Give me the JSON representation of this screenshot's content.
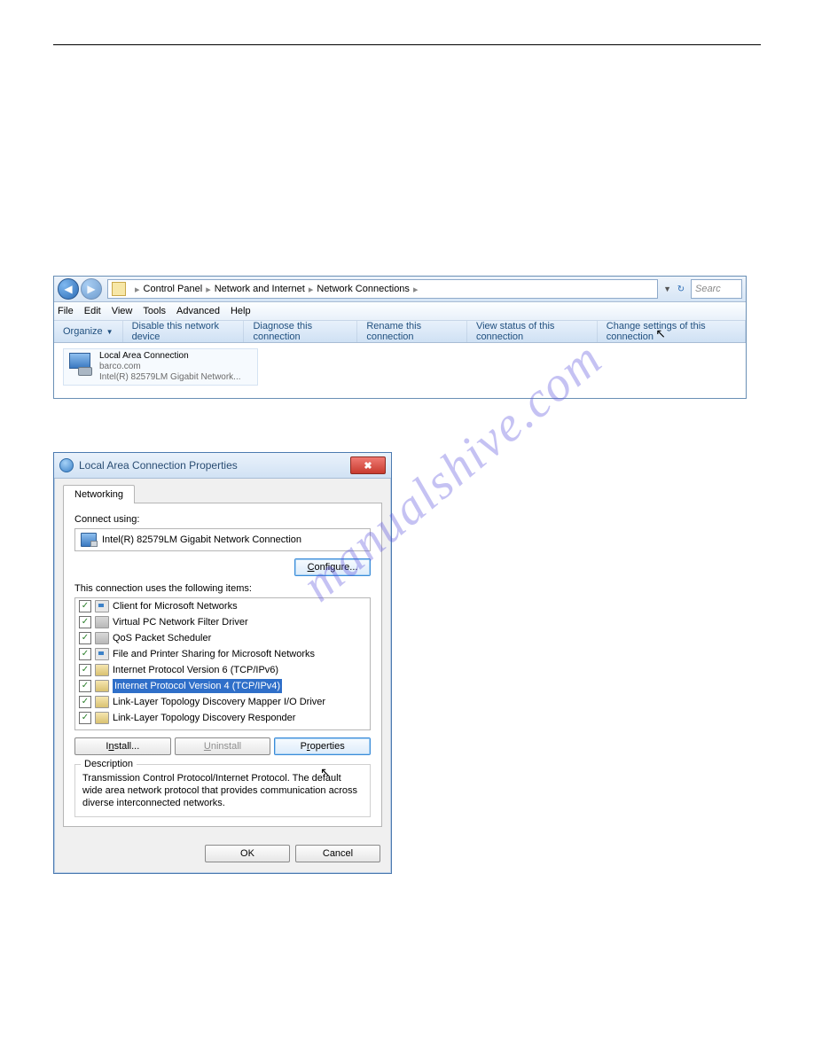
{
  "watermark": "manualshive.com",
  "cp": {
    "breadcrumb": [
      "Control Panel",
      "Network and Internet",
      "Network Connections"
    ],
    "search_placeholder": "Searc",
    "menu": [
      "File",
      "Edit",
      "View",
      "Tools",
      "Advanced",
      "Help"
    ],
    "toolbar": {
      "organize": "Organize",
      "disable": "Disable this network device",
      "diagnose": "Diagnose this connection",
      "rename": "Rename this connection",
      "viewstatus": "View status of this connection",
      "change": "Change settings of this connection"
    },
    "connection": {
      "title": "Local Area Connection",
      "domain": "barco.com",
      "device": "Intel(R) 82579LM Gigabit Network..."
    }
  },
  "dlg": {
    "title": "Local Area Connection Properties",
    "tab": "Networking",
    "connect_using_label": "Connect using:",
    "adapter": "Intel(R) 82579LM Gigabit Network Connection",
    "configure": "Configure...",
    "items_label": "This connection uses the following items:",
    "items": [
      {
        "label": "Client for Microsoft Networks",
        "icon": "net"
      },
      {
        "label": "Virtual PC Network Filter Driver",
        "icon": "srv"
      },
      {
        "label": "QoS Packet Scheduler",
        "icon": "srv"
      },
      {
        "label": "File and Printer Sharing for Microsoft Networks",
        "icon": "net"
      },
      {
        "label": "Internet Protocol Version 6 (TCP/IPv6)",
        "icon": "tcp"
      },
      {
        "label": "Internet Protocol Version 4 (TCP/IPv4)",
        "icon": "tcp",
        "selected": true
      },
      {
        "label": "Link-Layer Topology Discovery Mapper I/O Driver",
        "icon": "tcp"
      },
      {
        "label": "Link-Layer Topology Discovery Responder",
        "icon": "tcp"
      }
    ],
    "install": "Install...",
    "uninstall": "Uninstall",
    "properties": "Properties",
    "desc_title": "Description",
    "description": "Transmission Control Protocol/Internet Protocol. The default wide area network protocol that provides communication across diverse interconnected networks.",
    "ok": "OK",
    "cancel": "Cancel"
  }
}
